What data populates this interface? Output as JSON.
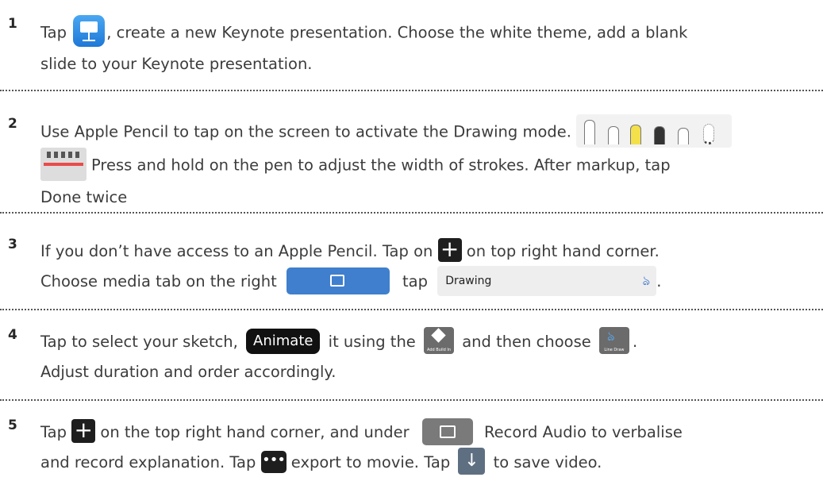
{
  "steps": [
    {
      "number": "1",
      "line1_before": "Tap ",
      "line1_after": ", create a new Keynote presentation. Choose the white theme, add a blank",
      "line2": "slide to your Keynote presentation.",
      "icons": [
        "keynote-icon"
      ]
    },
    {
      "number": "2",
      "line1": "Use Apple Pencil to tap on the screen to activate the Drawing mode.",
      "line2": "Press and hold on the pen to adjust the width of strokes. After markup, tap",
      "line3": "Done twice",
      "icons": [
        "drawing-tools-icon",
        "stroke-width-icon"
      ]
    },
    {
      "number": "3",
      "line1_before": "If you don’t have access to an Apple Pencil. Tap on ",
      "line1_after": " on top right hand corner.",
      "line2_before": "Choose media tab on the right ",
      "line2_mid": "tap ",
      "drawing_label": "Drawing",
      "line2_after": ".",
      "icons": [
        "plus-icon",
        "media-tab-icon",
        "drawing-icon"
      ]
    },
    {
      "number": "4",
      "line1_before": "Tap to select your sketch, ",
      "animate_label": "Animate",
      "line1_mid1": " it using the ",
      "add_build_label": "Add Build In",
      "line1_mid2": " and then choose ",
      "line_draw_label": "Line Draw",
      "line1_after": ".",
      "line2": "Adjust duration and order accordingly.",
      "icons": [
        "add-build-in-icon",
        "line-draw-icon"
      ]
    },
    {
      "number": "5",
      "line1_before": "Tap ",
      "line1_mid": " on the top right hand corner, and under ",
      "line1_after": " Record Audio to verbalise",
      "line2_before": "and record explanation. Tap ",
      "line2_mid": " export to movie. Tap ",
      "line2_after": " to save video.",
      "icons": [
        "plus-icon",
        "gallery-icon",
        "more-icon",
        "save-icon"
      ]
    }
  ]
}
